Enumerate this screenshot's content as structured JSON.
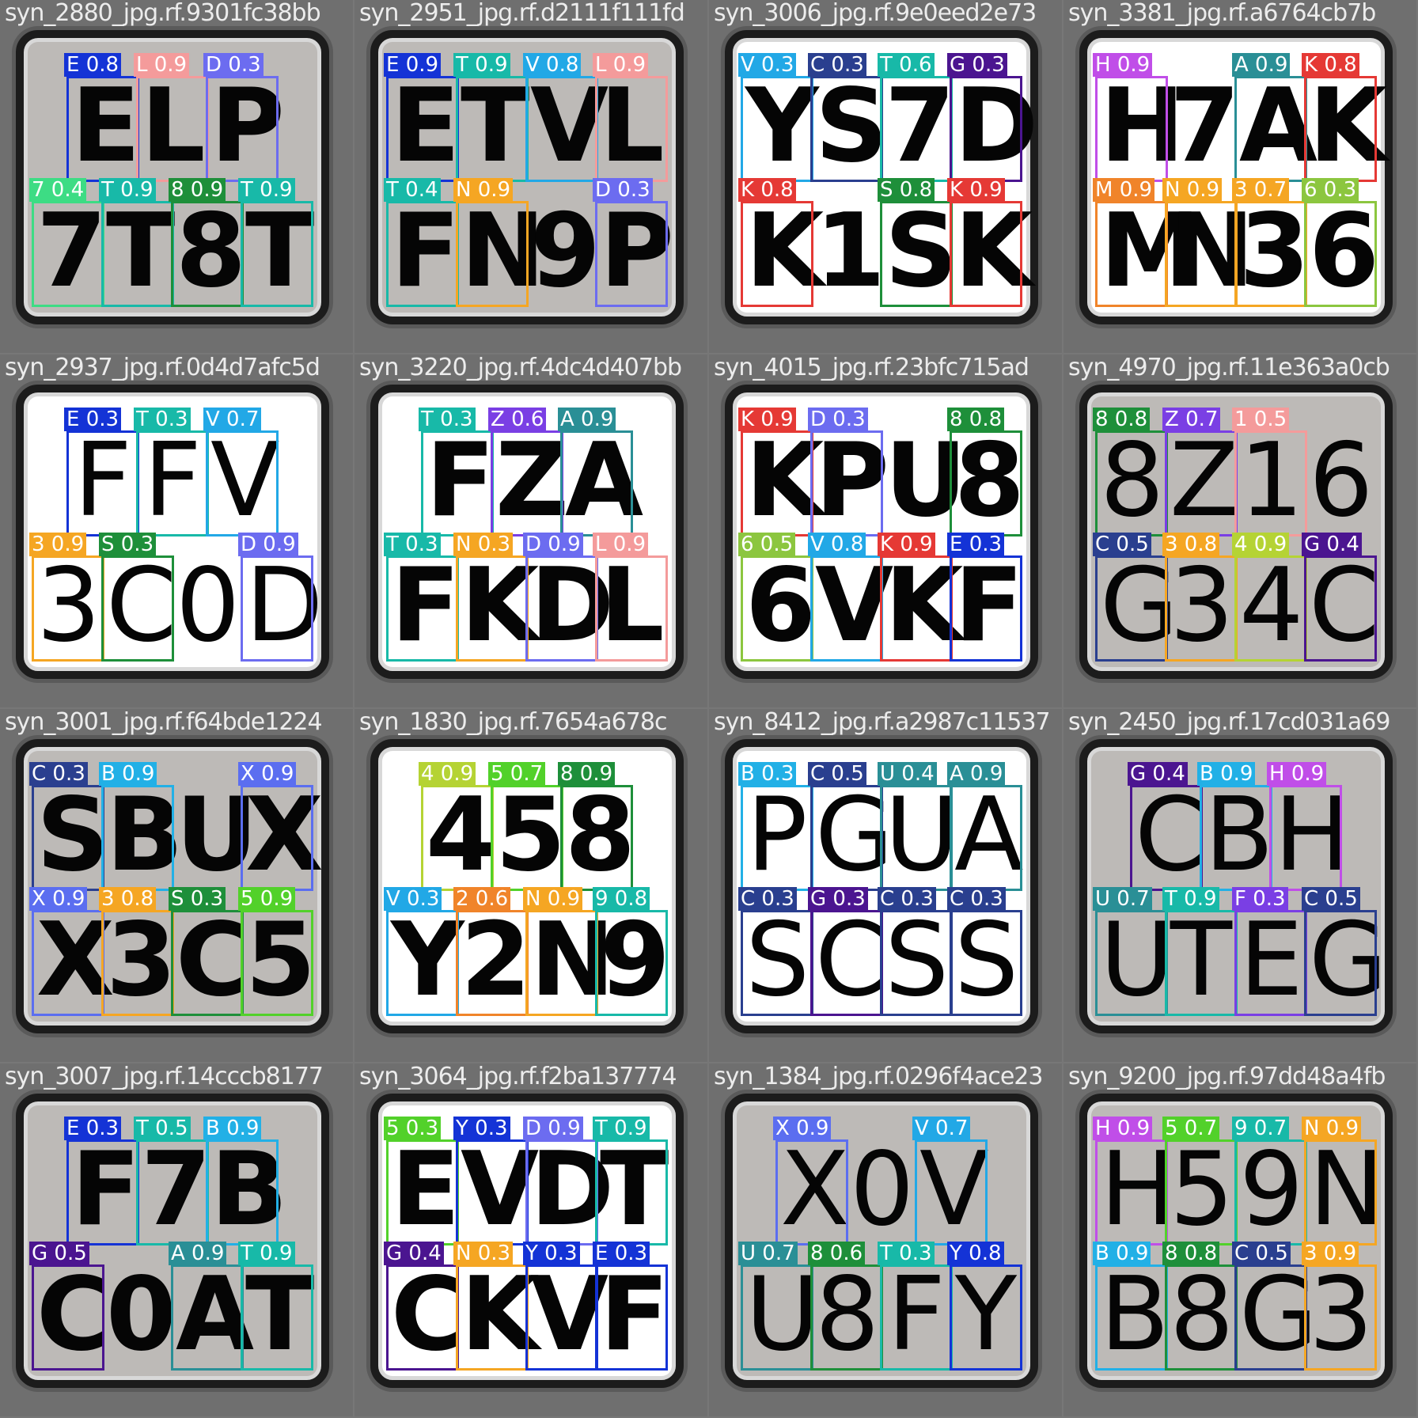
{
  "tiles": [
    {
      "file": "syn_2880_jpg.rf.9301fc38bb",
      "bg": "gray",
      "thin": false,
      "top": [
        {
          "c": "E",
          "l": "E 0.8",
          "col": "#1433d6"
        },
        {
          "c": "L",
          "l": "L 0.9",
          "col": "#f49b9b"
        },
        {
          "c": "P",
          "l": "D 0.3",
          "col": "#6c6cf0"
        }
      ],
      "bot": [
        {
          "c": "7",
          "l": "7 0.4",
          "col": "#3ddc84"
        },
        {
          "c": "T",
          "l": "T 0.9",
          "col": "#18b9a8"
        },
        {
          "c": "8",
          "l": "8 0.9",
          "col": "#1e8f3a"
        },
        {
          "c": "T",
          "l": "T 0.9",
          "col": "#18b9a8"
        }
      ]
    },
    {
      "file": "syn_2951_jpg.rf.d2111f111fd",
      "bg": "gray",
      "thin": false,
      "top": [
        {
          "c": "E",
          "l": "E 0.9",
          "col": "#1433d6"
        },
        {
          "c": "T",
          "l": "T 0.9",
          "col": "#18b9a8"
        },
        {
          "c": "V",
          "l": "V 0.8",
          "col": "#22a8e6"
        },
        {
          "c": "L",
          "l": "L 0.9",
          "col": "#f49b9b"
        }
      ],
      "bot": [
        {
          "c": "F",
          "l": "T 0.4",
          "col": "#18b9a8"
        },
        {
          "c": "N",
          "l": "N 0.9",
          "col": "#f5a623"
        },
        {
          "c": "9",
          "l": "",
          "col": "#888888"
        },
        {
          "c": "P",
          "l": "D 0.3",
          "col": "#6c6cf0"
        }
      ]
    },
    {
      "file": "syn_3006_jpg.rf.9e0eed2e73",
      "bg": "white",
      "thin": false,
      "top": [
        {
          "c": "Y",
          "l": "V 0.3",
          "col": "#22a8e6"
        },
        {
          "c": "S",
          "l": "C 0.3",
          "col": "#2a3f8f"
        },
        {
          "c": "7",
          "l": "T 0.6",
          "col": "#18b9a8"
        },
        {
          "c": "D",
          "l": "G 0.3",
          "col": "#4b1590"
        }
      ],
      "bot": [
        {
          "c": "K",
          "l": "K 0.8",
          "col": "#e53935"
        },
        {
          "c": "1",
          "l": "",
          "col": "#888888"
        },
        {
          "c": "S",
          "l": "S 0.8",
          "col": "#1e8f3a"
        },
        {
          "c": "K",
          "l": "K 0.9",
          "col": "#e53935"
        }
      ]
    },
    {
      "file": "syn_3381_jpg.rf.a6764cb7b",
      "bg": "white",
      "thin": false,
      "top": [
        {
          "c": "H",
          "l": "H 0.9",
          "col": "#c04ee8"
        },
        {
          "c": "7",
          "l": "",
          "col": "#888888"
        },
        {
          "c": "A",
          "l": "A 0.9",
          "col": "#2a8f96"
        },
        {
          "c": "K",
          "l": "K 0.8",
          "col": "#e53935"
        }
      ],
      "bot": [
        {
          "c": "M",
          "l": "M 0.9",
          "col": "#f0842a"
        },
        {
          "c": "N",
          "l": "N 0.9",
          "col": "#f5a623"
        },
        {
          "c": "3",
          "l": "3 0.7",
          "col": "#f5a623"
        },
        {
          "c": "6",
          "l": "6 0.3",
          "col": "#8cc63f"
        }
      ]
    },
    {
      "file": "syn_2937_jpg.rf.0d4d7afc5d",
      "bg": "white",
      "thin": true,
      "top": [
        {
          "c": "F",
          "l": "E 0.3",
          "col": "#1433d6"
        },
        {
          "c": "F",
          "l": "T 0.3",
          "col": "#18b9a8"
        },
        {
          "c": "V",
          "l": "V 0.7",
          "col": "#22a8e6"
        }
      ],
      "bot": [
        {
          "c": "3",
          "l": "3 0.9",
          "col": "#f5a623"
        },
        {
          "c": "C",
          "l": "S 0.3",
          "col": "#1e8f3a"
        },
        {
          "c": "0",
          "l": "",
          "col": "#888888"
        },
        {
          "c": "D",
          "l": "D 0.9",
          "col": "#6c6cf0"
        }
      ]
    },
    {
      "file": "syn_3220_jpg.rf.4dc4d407bb",
      "bg": "white",
      "thin": false,
      "top": [
        {
          "c": "F",
          "l": "T 0.3",
          "col": "#18b9a8"
        },
        {
          "c": "Z",
          "l": "Z 0.6",
          "col": "#7a3fe4"
        },
        {
          "c": "A",
          "l": "A 0.9",
          "col": "#2a8f96"
        }
      ],
      "bot": [
        {
          "c": "F",
          "l": "T 0.3",
          "col": "#18b9a8"
        },
        {
          "c": "K",
          "l": "N 0.3",
          "col": "#f5a623"
        },
        {
          "c": "D",
          "l": "D 0.9",
          "col": "#6c6cf0"
        },
        {
          "c": "L",
          "l": "L 0.9",
          "col": "#f49b9b"
        }
      ]
    },
    {
      "file": "syn_4015_jpg.rf.23bfc715ad",
      "bg": "white",
      "thin": false,
      "top": [
        {
          "c": "K",
          "l": "K 0.9",
          "col": "#e53935"
        },
        {
          "c": "P",
          "l": "D 0.3",
          "col": "#6c6cf0"
        },
        {
          "c": "U",
          "l": "",
          "col": "#888888"
        },
        {
          "c": "8",
          "l": "8 0.8",
          "col": "#1e8f3a"
        }
      ],
      "bot": [
        {
          "c": "6",
          "l": "6 0.5",
          "col": "#8cc63f"
        },
        {
          "c": "V",
          "l": "V 0.8",
          "col": "#22a8e6"
        },
        {
          "c": "K",
          "l": "K 0.9",
          "col": "#e53935"
        },
        {
          "c": "F",
          "l": "E 0.3",
          "col": "#1433d6"
        }
      ]
    },
    {
      "file": "syn_4970_jpg.rf.11e363a0cb",
      "bg": "gray",
      "thin": true,
      "top": [
        {
          "c": "8",
          "l": "8 0.8",
          "col": "#1e8f3a"
        },
        {
          "c": "Z",
          "l": "Z 0.7",
          "col": "#7a3fe4"
        },
        {
          "c": "1",
          "l": "1 0.5",
          "col": "#f49b9b"
        },
        {
          "c": "6",
          "l": "",
          "col": "#888888"
        }
      ],
      "bot": [
        {
          "c": "G",
          "l": "C 0.5",
          "col": "#2a3f8f"
        },
        {
          "c": "3",
          "l": "3 0.8",
          "col": "#f5a623"
        },
        {
          "c": "4",
          "l": "4 0.9",
          "col": "#b5d334"
        },
        {
          "c": "C",
          "l": "G 0.4",
          "col": "#4b1590"
        }
      ]
    },
    {
      "file": "syn_3001_jpg.rf.f64bde1224",
      "bg": "gray",
      "thin": false,
      "top": [
        {
          "c": "S",
          "l": "C 0.3",
          "col": "#2a3f8f"
        },
        {
          "c": "B",
          "l": "B 0.9",
          "col": "#22b0e6"
        },
        {
          "c": "U",
          "l": "",
          "col": "#888888"
        },
        {
          "c": "X",
          "l": "X 0.9",
          "col": "#5b6ef0"
        }
      ],
      "bot": [
        {
          "c": "X",
          "l": "X 0.9",
          "col": "#5b6ef0"
        },
        {
          "c": "3",
          "l": "3 0.8",
          "col": "#f5a623"
        },
        {
          "c": "C",
          "l": "S 0.3",
          "col": "#1e8f3a"
        },
        {
          "c": "5",
          "l": "5 0.9",
          "col": "#52d12a"
        }
      ]
    },
    {
      "file": "syn_1830_jpg.rf.7654a678c",
      "bg": "white",
      "thin": false,
      "top": [
        {
          "c": "4",
          "l": "4 0.9",
          "col": "#b5d334"
        },
        {
          "c": "5",
          "l": "5 0.7",
          "col": "#52d12a"
        },
        {
          "c": "8",
          "l": "8 0.9",
          "col": "#1e8f3a"
        }
      ],
      "bot": [
        {
          "c": "Y",
          "l": "V 0.3",
          "col": "#22a8e6"
        },
        {
          "c": "2",
          "l": "2 0.6",
          "col": "#f0842a"
        },
        {
          "c": "N",
          "l": "N 0.9",
          "col": "#f5a623"
        },
        {
          "c": "9",
          "l": "9 0.8",
          "col": "#18b9a8"
        }
      ]
    },
    {
      "file": "syn_8412_jpg.rf.a2987c11537",
      "bg": "white",
      "thin": true,
      "top": [
        {
          "c": "P",
          "l": "B 0.3",
          "col": "#22b0e6"
        },
        {
          "c": "G",
          "l": "C 0.5",
          "col": "#2a3f8f"
        },
        {
          "c": "U",
          "l": "U 0.4",
          "col": "#2a8f96"
        },
        {
          "c": "A",
          "l": "A 0.9",
          "col": "#2a8f96"
        }
      ],
      "bot": [
        {
          "c": "S",
          "l": "C 0.3",
          "col": "#2a3f8f"
        },
        {
          "c": "C",
          "l": "G 0.3",
          "col": "#4b1590"
        },
        {
          "c": "S",
          "l": "C 0.3",
          "col": "#2a3f8f"
        },
        {
          "c": "S",
          "l": "C 0.3",
          "col": "#2a3f8f"
        }
      ]
    },
    {
      "file": "syn_2450_jpg.rf.17cd031a69",
      "bg": "gray",
      "thin": true,
      "top": [
        {
          "c": "C",
          "l": "G 0.4",
          "col": "#4b1590"
        },
        {
          "c": "B",
          "l": "B 0.9",
          "col": "#22b0e6"
        },
        {
          "c": "H",
          "l": "H 0.9",
          "col": "#c04ee8"
        }
      ],
      "bot": [
        {
          "c": "U",
          "l": "U 0.7",
          "col": "#2a8f96"
        },
        {
          "c": "T",
          "l": "T 0.9",
          "col": "#18b9a8"
        },
        {
          "c": "E",
          "l": "F 0.3",
          "col": "#7a3fe4"
        },
        {
          "c": "G",
          "l": "C 0.5",
          "col": "#2a3f8f"
        }
      ]
    },
    {
      "file": "syn_3007_jpg.rf.14cccb8177",
      "bg": "gray",
      "thin": false,
      "top": [
        {
          "c": "F",
          "l": "E 0.3",
          "col": "#1433d6"
        },
        {
          "c": "7",
          "l": "T 0.5",
          "col": "#18b9a8"
        },
        {
          "c": "B",
          "l": "B 0.9",
          "col": "#22b0e6"
        }
      ],
      "bot": [
        {
          "c": "C",
          "l": "G 0.5",
          "col": "#4b1590"
        },
        {
          "c": "0",
          "l": "",
          "col": "#888888"
        },
        {
          "c": "A",
          "l": "A 0.9",
          "col": "#2a8f96"
        },
        {
          "c": "T",
          "l": "T 0.9",
          "col": "#18b9a8"
        }
      ]
    },
    {
      "file": "syn_3064_jpg.rf.f2ba137774",
      "bg": "white",
      "thin": false,
      "top": [
        {
          "c": "E",
          "l": "5 0.3",
          "col": "#52d12a"
        },
        {
          "c": "V",
          "l": "Y 0.3",
          "col": "#1433d6"
        },
        {
          "c": "D",
          "l": "D 0.9",
          "col": "#6c6cf0"
        },
        {
          "c": "T",
          "l": "T 0.9",
          "col": "#18b9a8"
        }
      ],
      "bot": [
        {
          "c": "C",
          "l": "G 0.4",
          "col": "#4b1590"
        },
        {
          "c": "K",
          "l": "N 0.3",
          "col": "#f5a623"
        },
        {
          "c": "V",
          "l": "Y 0.3",
          "col": "#1433d6"
        },
        {
          "c": "F",
          "l": "E 0.3",
          "col": "#1433d6"
        }
      ]
    },
    {
      "file": "syn_1384_jpg.rf.0296f4ace23",
      "bg": "gray",
      "thin": true,
      "top": [
        {
          "c": "X",
          "l": "X 0.9",
          "col": "#5b6ef0"
        },
        {
          "c": "0",
          "l": "",
          "col": "#888888"
        },
        {
          "c": "V",
          "l": "V 0.7",
          "col": "#22a8e6"
        }
      ],
      "bot": [
        {
          "c": "U",
          "l": "U 0.7",
          "col": "#2a8f96"
        },
        {
          "c": "8",
          "l": "8 0.6",
          "col": "#1e8f3a"
        },
        {
          "c": "F",
          "l": "T 0.3",
          "col": "#18b9a8"
        },
        {
          "c": "Y",
          "l": "Y 0.8",
          "col": "#1433d6"
        }
      ]
    },
    {
      "file": "syn_9200_jpg.rf.97dd48a4fb",
      "bg": "gray",
      "thin": true,
      "top": [
        {
          "c": "H",
          "l": "H 0.9",
          "col": "#c04ee8"
        },
        {
          "c": "5",
          "l": "5 0.7",
          "col": "#52d12a"
        },
        {
          "c": "9",
          "l": "9 0.7",
          "col": "#18b9a8"
        },
        {
          "c": "N",
          "l": "N 0.9",
          "col": "#f5a623"
        }
      ],
      "bot": [
        {
          "c": "B",
          "l": "B 0.9",
          "col": "#22b0e6"
        },
        {
          "c": "8",
          "l": "8 0.8",
          "col": "#1e8f3a"
        },
        {
          "c": "G",
          "l": "C 0.5",
          "col": "#2a3f8f"
        },
        {
          "c": "3",
          "l": "3 0.9",
          "col": "#f5a623"
        }
      ]
    }
  ]
}
